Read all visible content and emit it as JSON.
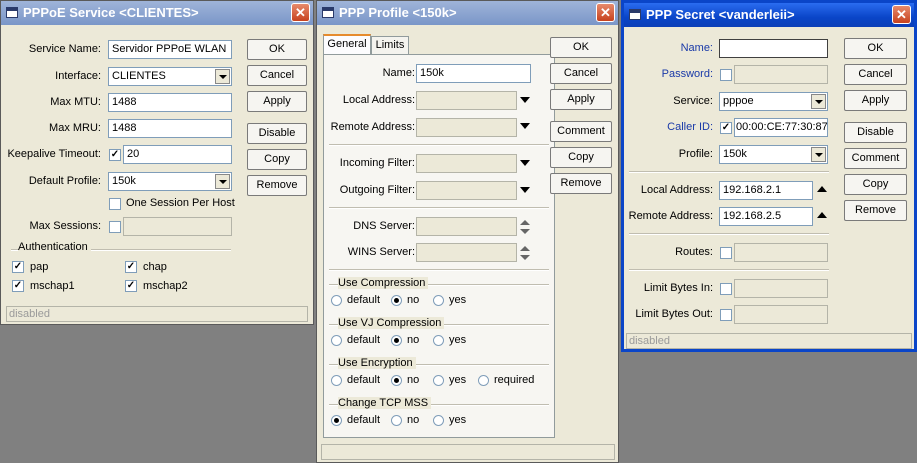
{
  "windows": {
    "pppoe": {
      "title": "PPPoE Service <CLIENTES>",
      "close_glyph": "✕",
      "service_name_label": "Service Name:",
      "service_name_value": "Servidor PPPoE WLAN",
      "interface_label": "Interface:",
      "interface_value": "CLIENTES",
      "max_mtu_label": "Max MTU:",
      "max_mtu_value": "1488",
      "max_mru_label": "Max MRU:",
      "max_mru_value": "1488",
      "keepalive_label": "Keepalive Timeout:",
      "keepalive_value": "20",
      "default_profile_label": "Default Profile:",
      "default_profile_value": "150k",
      "one_session_label": "One Session Per Host",
      "max_sessions_label": "Max Sessions:",
      "auth_group": "Authentication",
      "auth": {
        "pap": "pap",
        "chap": "chap",
        "mschap1": "mschap1",
        "mschap2": "mschap2"
      },
      "buttons": {
        "ok": "OK",
        "cancel": "Cancel",
        "apply": "Apply",
        "disable": "Disable",
        "copy": "Copy",
        "remove": "Remove"
      },
      "status": "disabled"
    },
    "profile": {
      "title": "PPP Profile <150k>",
      "close_glyph": "✕",
      "tabs": {
        "general": "General",
        "limits": "Limits"
      },
      "name_label": "Name:",
      "name_value": "150k",
      "local_address_label": "Local Address:",
      "remote_address_label": "Remote Address:",
      "incoming_filter_label": "Incoming Filter:",
      "outgoing_filter_label": "Outgoing Filter:",
      "dns_server_label": "DNS Server:",
      "wins_server_label": "WINS Server:",
      "use_compression": "Use Compression",
      "use_vj_compression": "Use VJ Compression",
      "use_encryption": "Use Encryption",
      "change_tcp_mss": "Change TCP MSS",
      "opt_default": "default",
      "opt_no": "no",
      "opt_yes": "yes",
      "opt_required": "required",
      "buttons": {
        "ok": "OK",
        "cancel": "Cancel",
        "apply": "Apply",
        "comment": "Comment",
        "copy": "Copy",
        "remove": "Remove"
      }
    },
    "secret": {
      "title": "PPP Secret <vanderleii>",
      "close_glyph": "✕",
      "name_label": "Name:",
      "name_value": "",
      "password_label": "Password:",
      "service_label": "Service:",
      "service_value": "pppoe",
      "caller_id_label": "Caller ID:",
      "caller_id_value": "00:00:CE:77:30:87",
      "profile_label": "Profile:",
      "profile_value": "150k",
      "local_address_label": "Local Address:",
      "local_address_value": "192.168.2.1",
      "remote_address_label": "Remote Address:",
      "remote_address_value": "192.168.2.5",
      "routes_label": "Routes:",
      "limit_in_label": "Limit Bytes In:",
      "limit_out_label": "Limit Bytes Out:",
      "buttons": {
        "ok": "OK",
        "cancel": "Cancel",
        "apply": "Apply",
        "disable": "Disable",
        "comment": "Comment",
        "copy": "Copy",
        "remove": "Remove"
      },
      "status": "disabled"
    }
  },
  "checks": {
    "pppoe_keepalive": true,
    "pppoe_one_session": false,
    "pppoe_max_sessions": false,
    "pppoe_pap": true,
    "pppoe_chap": true,
    "pppoe_mschap1": true,
    "pppoe_mschap2": true,
    "secret_password": false,
    "secret_caller_id": true,
    "secret_routes": false,
    "secret_limit_in": false,
    "secret_limit_out": false
  },
  "radios": {
    "use_compression": "no",
    "use_vj_compression": "no",
    "use_encryption": "no",
    "change_tcp_mss": "default"
  },
  "colors": {
    "active_title": "#0a45c8",
    "inactive_title": "#7a96c8",
    "dialog_bg": "#ece9d8",
    "label_blue": "#1a3aa8"
  },
  "icons": {
    "close": "close-icon",
    "check": "check-icon",
    "dropdown": "chevron-down-icon"
  }
}
